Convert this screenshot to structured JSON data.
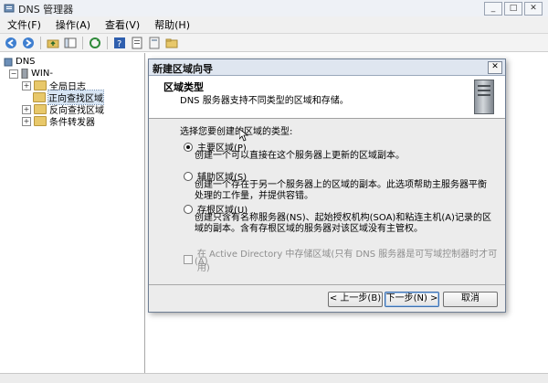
{
  "window": {
    "title": "DNS 管理器",
    "buttons": [
      "_",
      "□",
      "✕"
    ]
  },
  "menu": {
    "items": [
      "文件(F)",
      "操作(A)",
      "查看(V)",
      "帮助(H)"
    ]
  },
  "toolbar": {
    "icons": [
      "back-icon",
      "forward-icon",
      "up-folder-icon",
      "show-tree-icon",
      "refresh-icon",
      "help-icon",
      "properties-icon",
      "new-zone-icon",
      "folder-icon"
    ]
  },
  "tree": {
    "root": "DNS",
    "server": "WIN-",
    "items": [
      {
        "label": "全局日志",
        "expander": "+"
      },
      {
        "label": "正向查找区域",
        "expander": ""
      },
      {
        "label": "反向查找区域",
        "expander": "+"
      },
      {
        "label": "条件转发器",
        "expander": "+"
      }
    ]
  },
  "dialog": {
    "title": "新建区域向导",
    "close": "✕",
    "header_title": "区域类型",
    "header_subtitle": "DNS 服务器支持不同类型的区域和存储。",
    "prompt": "选择您要创建的区域的类型:",
    "options": [
      {
        "label": "主要区域(P)",
        "selected": true,
        "desc": [
          "创建一个可以直接在这个服务器上更新的区域副本。"
        ]
      },
      {
        "label": "辅助区域(S)",
        "selected": false,
        "desc": [
          "创建一个存在于另一个服务器上的区域的副本。此选项帮助主服务器平衡",
          "处理的工作量，并提供容错。"
        ]
      },
      {
        "label": "存根区域(U)",
        "selected": false,
        "desc": [
          "创建只含有名称服务器(NS)、起始授权机构(SOA)和粘连主机(A)记录的区",
          "域的副本。含有存根区域的服务器对该区域没有主管权。"
        ]
      }
    ],
    "ad_checkbox": [
      "在 Active Directory 中存储区域(只有 DNS 服务器是可写域控制器时才可用)",
      "(A)"
    ],
    "buttons": {
      "back": "< 上一步(B)",
      "next": "下一步(N) >",
      "cancel": "取消"
    }
  }
}
